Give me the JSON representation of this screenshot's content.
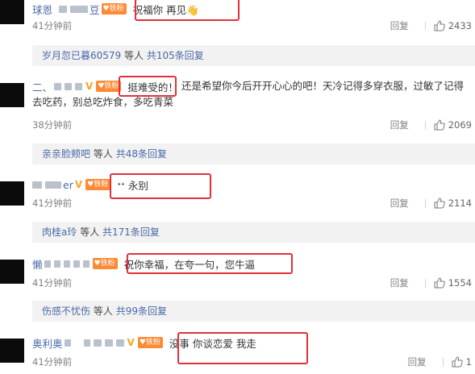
{
  "comments": [
    {
      "username": "球恩",
      "username_suffix": "豆",
      "text": "祝福你 再见👋",
      "time": "41分钟前",
      "reply_label": "回复",
      "likes": "2433",
      "replies": {
        "first": "岁月忽已暮60579",
        "mid": "等人",
        "count": "共105条回复"
      }
    },
    {
      "username": "二、",
      "text_boxed": "挺难受的！",
      "text_rest": "还是希望你今后开开心心的吧！天冷记得多穿衣服，过敏了记得去吃药，别总吃炸食，多吃青菜",
      "time": "38分钟前",
      "reply_label": "回复",
      "likes": "2069",
      "replies": {
        "first": "亲亲脸颊吧",
        "mid": "等人",
        "count": "共48条回复"
      }
    },
    {
      "username_suffix": "er",
      "text": "ᐩᐩ 永别",
      "time": "41分钟前",
      "reply_label": "回复",
      "likes": "2114",
      "replies": {
        "first": "肉桂a玲",
        "mid": "等人",
        "count": "共171条回复"
      }
    },
    {
      "username": "懒",
      "text": "祝你幸福，在夸一句，您牛逼",
      "time": "41分钟前",
      "reply_label": "回复",
      "likes": "1554",
      "replies": {
        "first": "伤感不忧伤",
        "mid": "等人",
        "count": "共99条回复"
      }
    },
    {
      "username": "奥利奥",
      "text": "没事 你谈恋爱 我走",
      "time": "41分钟前",
      "reply_label": "回复",
      "likes": "1"
    }
  ],
  "icons": {
    "like": "thumbs-up-icon",
    "fan_badge": "heart-fan-badge"
  },
  "colors": {
    "username": "#4a69a8",
    "highlight": "#e0313c",
    "badge": "#ff8a33",
    "replies_bg": "#f2f2f2"
  }
}
